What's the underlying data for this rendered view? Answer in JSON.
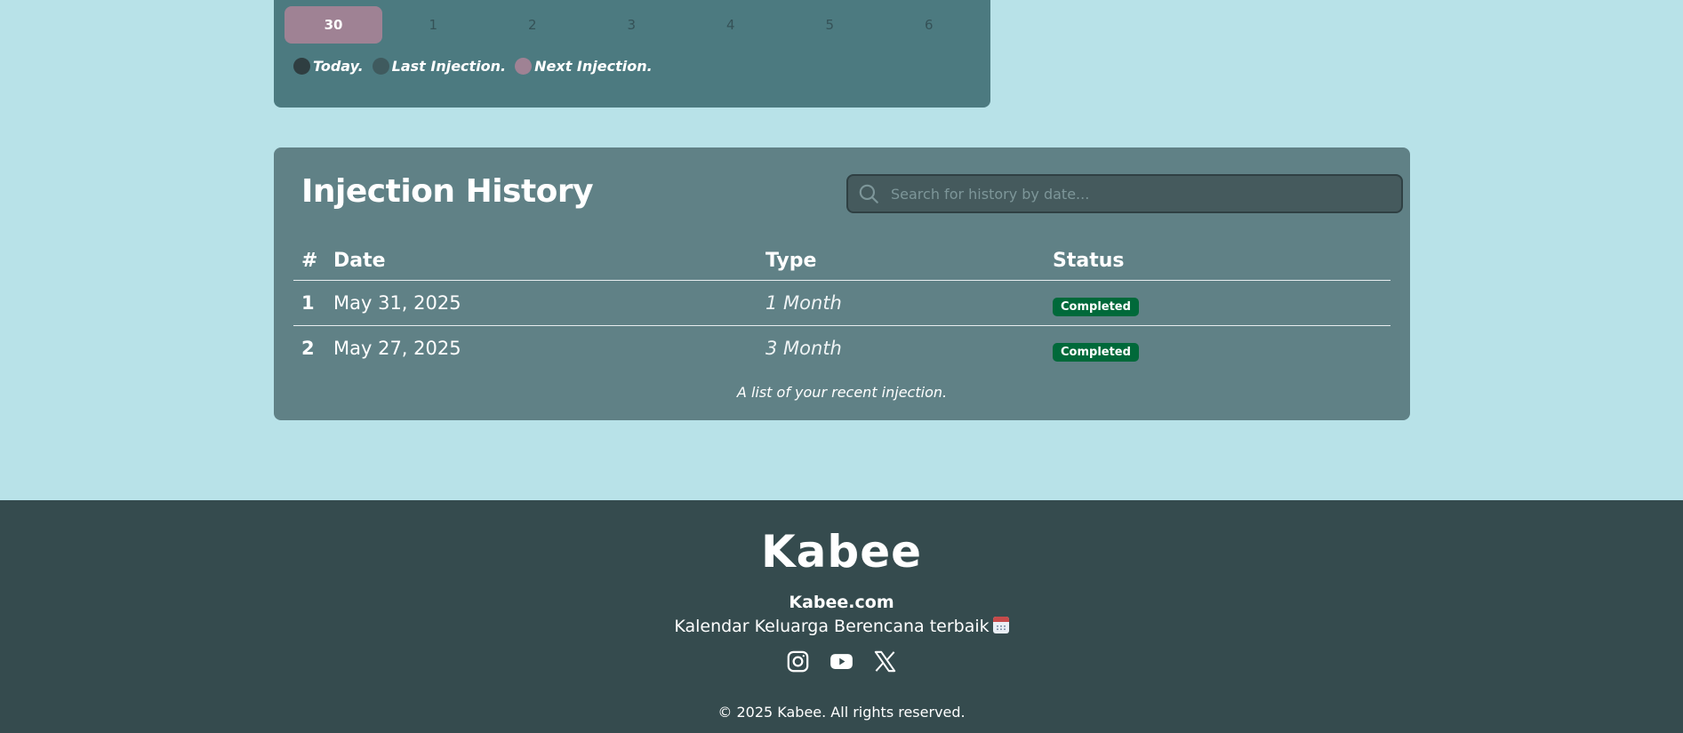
{
  "calendar": {
    "days": [
      {
        "label": "30",
        "selected": true
      },
      {
        "label": "1",
        "selected": false
      },
      {
        "label": "2",
        "selected": false
      },
      {
        "label": "3",
        "selected": false
      },
      {
        "label": "4",
        "selected": false
      },
      {
        "label": "5",
        "selected": false
      },
      {
        "label": "6",
        "selected": false
      }
    ],
    "legend": [
      {
        "label": "Today.",
        "color": "#2f3e41"
      },
      {
        "label": "Last Injection.",
        "color": "#3f5a5e"
      },
      {
        "label": "Next Injection.",
        "color": "#9f8294"
      }
    ],
    "colors": {
      "card": "#4c7a80",
      "selected_day": "#9f8294"
    }
  },
  "history": {
    "title": "Injection History",
    "search_placeholder": "Search for history by date...",
    "columns": [
      "#",
      "Date",
      "Type",
      "Status"
    ],
    "rows": [
      {
        "num": "1",
        "date": "May 31, 2025",
        "type": "1 Month",
        "status": "Completed"
      },
      {
        "num": "2",
        "date": "May 27, 2025",
        "type": "3 Month",
        "status": "Completed"
      }
    ],
    "caption": "A list of your recent injection.",
    "colors": {
      "card": "#608186",
      "status_badge": "#00693a"
    }
  },
  "footer": {
    "brand": "Kabee",
    "site": "Kabee.com",
    "tagline": "Kalendar Keluarga Berencana terbaik",
    "tagline_icon": "calendar-emoji-icon",
    "socials": [
      "instagram-icon",
      "youtube-icon",
      "x-twitter-icon"
    ],
    "copyright": "© 2025 Kabee. All rights reserved.",
    "colors": {
      "background": "#354b4e"
    }
  },
  "page": {
    "background": "#b8e2e8"
  }
}
